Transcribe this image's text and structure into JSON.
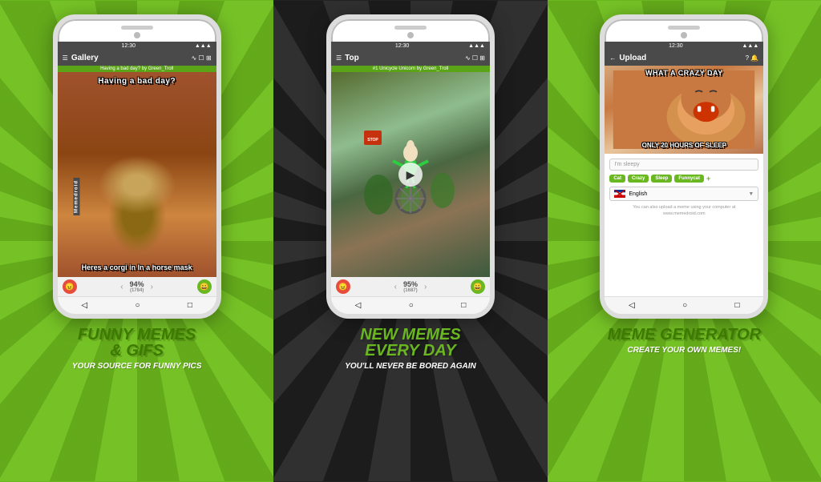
{
  "panels": [
    {
      "id": "left",
      "phone": {
        "statusbar": {
          "left": "",
          "time": "12:30",
          "icons": "▲▲▲"
        },
        "toolbar": {
          "menu": "☰",
          "title": "Gallery",
          "icons": "∿ ☐ ⊞"
        },
        "subtitle": "Having a bad day? by Green_Troll",
        "meme_top": "Having a bad day?",
        "meme_bottom": "Heres a corgi in\nIn a horse mask",
        "vote_percent": "94%",
        "vote_count": "(1784)",
        "navbar": [
          "◁",
          "○",
          "□"
        ]
      },
      "caption_main": "FUNNY MEMES\n& GIFS",
      "caption_sub": "YOUR SOURCE FOR FUNNY PICS"
    },
    {
      "id": "center",
      "phone": {
        "statusbar": {
          "left": "",
          "time": "12:30",
          "icons": "▲▲▲"
        },
        "toolbar": {
          "menu": "☰",
          "title": "Top",
          "icons": "∿ ☐ ⊞"
        },
        "subtitle": "#1 Unicycle Unicorn by Green_Troll",
        "has_video": true,
        "vote_percent": "95%",
        "vote_count": "(1687)",
        "navbar": [
          "◁",
          "○",
          "□"
        ]
      },
      "caption_main": "NEW MEMES\nEVERY DAY",
      "caption_sub": "YOU'LL NEVER BE BORED AGAIN"
    },
    {
      "id": "right",
      "phone": {
        "statusbar": {
          "left": "",
          "time": "12:30",
          "icons": "▲▲▲"
        },
        "toolbar": {
          "back": "←",
          "title": "Upload",
          "icons": "? 🔔"
        },
        "meme_top": "WHAT A CRAZY DAY",
        "meme_bottom": "ONLY 20 HOURS OF SLEEP",
        "input_placeholder": "I'm sleepy",
        "tags": [
          "Cat",
          "Crazy",
          "Sleep",
          "Funnycat"
        ],
        "language": "English",
        "note": "You can also upload a meme using your computer at\nwww.memedroid.com",
        "navbar": [
          "◁",
          "○",
          "□"
        ]
      },
      "caption_main": "MEME GENERATOR",
      "caption_sub": "CREATE YOUR OWN MEMES!"
    }
  ]
}
